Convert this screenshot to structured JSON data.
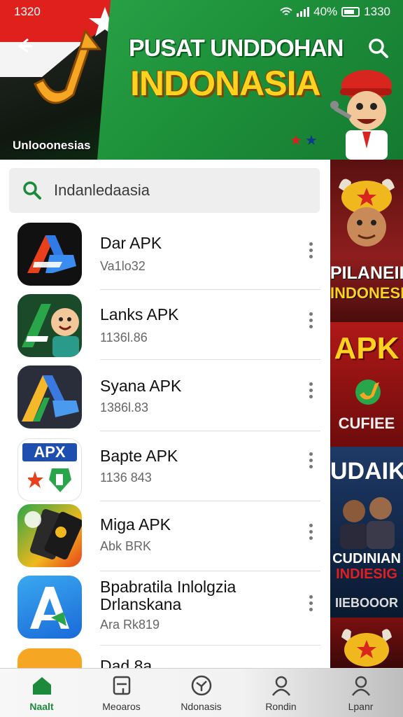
{
  "status_bar": {
    "time_left": "1320",
    "battery_percent": "40%",
    "time_right": "1330"
  },
  "banner": {
    "title_line1": "PUSAT UNDDOHAN",
    "title_line2": "INDONASIA",
    "caption": "Unlooonesias"
  },
  "search": {
    "text": "Indanledaasia"
  },
  "apps": [
    {
      "name": "Dar APK",
      "sub": "Va1lo32"
    },
    {
      "name": "Lanks APK",
      "sub": "1136l.86"
    },
    {
      "name": "Syana APK",
      "sub": "1386l.83"
    },
    {
      "name": "Bapte APK",
      "sub": "1136 843"
    },
    {
      "name": "Miga APK",
      "sub": "Abk BRK"
    },
    {
      "name": "Bpabratila Inlolgzia Drlanskana",
      "sub": "Ara Rk819"
    },
    {
      "name": "Dad 8a",
      "sub": ""
    }
  ],
  "app_icon_labels": {
    "bapte": "APX"
  },
  "ads": [
    {
      "line1": "PILANEII",
      "line2": "INDONESIA"
    },
    {
      "line1": "APK",
      "line2": "CUFIEE"
    },
    {
      "line1": "UDAIK",
      "line2": "CUDINIAN",
      "line3": "INDIESIG",
      "line4": "IIEBOOOR"
    }
  ],
  "bottom_nav": [
    {
      "label": "Naalt",
      "active": true
    },
    {
      "label": "Meoaros",
      "active": false
    },
    {
      "label": "Ndonasis",
      "active": false
    },
    {
      "label": "Rondin",
      "active": false
    },
    {
      "label": "Lpanr",
      "active": false
    }
  ],
  "colors": {
    "brand_green": "#1d8f3a",
    "title_yellow": "#ffd21f",
    "active_tab": "#1b8a3a"
  }
}
